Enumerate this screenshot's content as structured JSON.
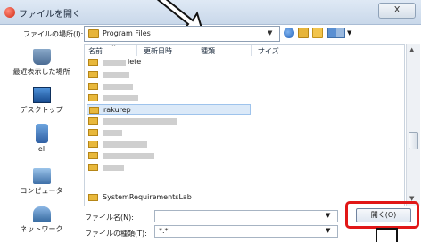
{
  "window": {
    "title": "ファイルを開く",
    "close_label": "X"
  },
  "location": {
    "label": "ファイルの場所(I):",
    "folder": "Program Files"
  },
  "columns": {
    "name": "名前",
    "modified": "更新日時",
    "type": "種類",
    "size": "サイズ"
  },
  "places": [
    {
      "label": "最近表示した場所",
      "icon": "recent-places-icon"
    },
    {
      "label": "デスクトップ",
      "icon": "desktop-icon"
    },
    {
      "label": "el",
      "icon": "user-folder-icon"
    },
    {
      "label": "コンピュータ",
      "icon": "computer-icon"
    },
    {
      "label": "ネットワーク",
      "icon": "network-icon"
    }
  ],
  "files": [
    {
      "label": "lete",
      "state": "partial"
    },
    {
      "label": "",
      "state": "blurred"
    },
    {
      "label": "",
      "state": "blurred"
    },
    {
      "label": "",
      "state": "blurred"
    },
    {
      "label": "rakurep",
      "state": "selected"
    },
    {
      "label": "",
      "state": "blurred"
    },
    {
      "label": "",
      "state": "blurred"
    },
    {
      "label": "",
      "state": "blurred"
    },
    {
      "label": "",
      "state": "blurred"
    },
    {
      "label": "",
      "state": "blurred"
    },
    {
      "label": "SystemRequirementsLab",
      "state": "partial"
    }
  ],
  "filename": {
    "label": "ファイル名(N):",
    "value": ""
  },
  "filetype": {
    "label": "ファイルの種類(T):",
    "value": "*.*"
  },
  "buttons": {
    "open": "開く(O)"
  }
}
